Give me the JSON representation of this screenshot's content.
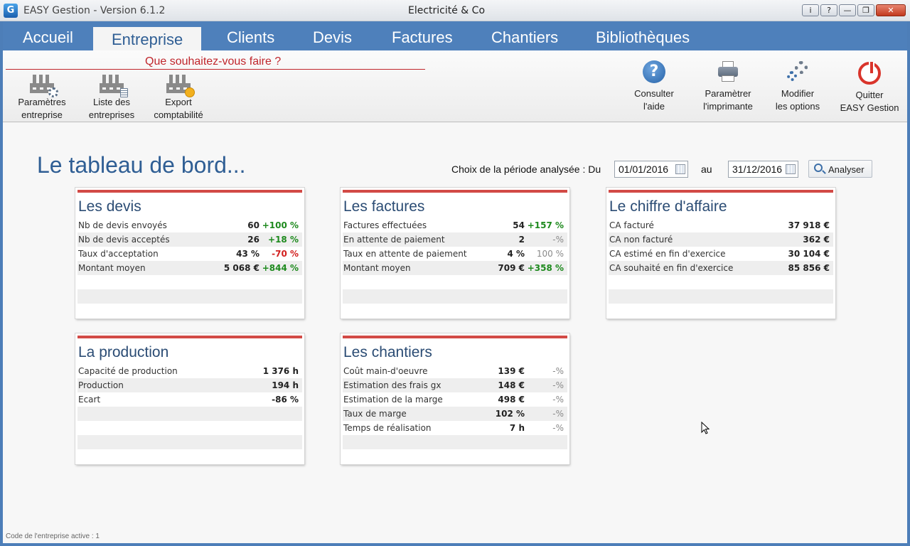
{
  "window": {
    "app_title": "EASY Gestion - Version 6.1.2",
    "company_title": "Electricité & Co",
    "app_icon": "G",
    "controls": [
      "i",
      "?",
      "—",
      "❐",
      "✕"
    ]
  },
  "nav": {
    "tabs": [
      "Accueil",
      "Entreprise",
      "Clients",
      "Devis",
      "Factures",
      "Chantiers",
      "Bibliothèques"
    ],
    "active": "Entreprise"
  },
  "ribbon": {
    "heading": "Que souhaitez-vous faire ?",
    "left_buttons": [
      {
        "line1": "Paramètres",
        "line2": "entreprise",
        "icon": "factory-gear-icon"
      },
      {
        "line1": "Liste des",
        "line2": "entreprises",
        "icon": "factory-list-icon"
      },
      {
        "line1": "Export",
        "line2": "comptabilité",
        "icon": "factory-export-icon"
      }
    ],
    "right_buttons": [
      {
        "line1": "Consulter",
        "line2": "l'aide",
        "icon": "help-icon"
      },
      {
        "line1": "Paramètrer",
        "line2": "l'imprimante",
        "icon": "printer-icon"
      },
      {
        "line1": "Modifier",
        "line2": "les options",
        "icon": "gears-icon"
      },
      {
        "line1": "Quitter",
        "line2": "EASY Gestion",
        "icon": "power-icon"
      }
    ]
  },
  "dashboard": {
    "title": "Le tableau de bord...",
    "period_label": "Choix de la période analysée : Du",
    "from_date": "01/01/2016",
    "to_label": "au",
    "to_date": "31/12/2016",
    "analyze_label": "Analyser"
  },
  "cards": {
    "devis": {
      "title": "Les devis",
      "rows": [
        {
          "label": "Nb de devis envoyés",
          "value": "60",
          "pct": "+100 %"
        },
        {
          "label": "Nb de devis acceptés",
          "value": "26",
          "pct": "+18 %"
        },
        {
          "label": "Taux d'acceptation",
          "value": "43 %",
          "pct": "-70 %"
        },
        {
          "label": "Montant moyen",
          "value": "5 068 €",
          "pct": "+844 %"
        }
      ]
    },
    "factures": {
      "title": "Les factures",
      "rows": [
        {
          "label": "Factures effectuées",
          "value": "54",
          "pct": "+157 %"
        },
        {
          "label": "En attente de paiement",
          "value": "2",
          "pct": "-%"
        },
        {
          "label": "Taux en attente de paiement",
          "value": "4 %",
          "pct": "100 %"
        },
        {
          "label": "Montant moyen",
          "value": "709 €",
          "pct": "+358 %"
        }
      ]
    },
    "ca": {
      "title": "Le chiffre d'affaire",
      "rows": [
        {
          "label": "CA facturé",
          "value": "37 918 €"
        },
        {
          "label": "CA non facturé",
          "value": "362 €"
        },
        {
          "label": "CA estimé en fin d'exercice",
          "value": "30 104 €"
        },
        {
          "label": "CA souhaité en fin d'exercice",
          "value": "85 856 €"
        }
      ]
    },
    "production": {
      "title": "La production",
      "rows": [
        {
          "label": "Capacité de production",
          "value": "1 376 h"
        },
        {
          "label": "Production",
          "value": "194 h"
        },
        {
          "label": "Ecart",
          "value": "-86 %"
        }
      ]
    },
    "chantiers": {
      "title": "Les chantiers",
      "rows": [
        {
          "label": "Coût main-d'oeuvre",
          "value": "139 €",
          "pct": "-%"
        },
        {
          "label": "Estimation des frais gx",
          "value": "148 €",
          "pct": "-%"
        },
        {
          "label": "Estimation de la marge",
          "value": "498 €",
          "pct": "-%"
        },
        {
          "label": "Taux de marge",
          "value": "102 %",
          "pct": "-%"
        },
        {
          "label": "Temps de réalisation",
          "value": "7 h",
          "pct": "-%"
        }
      ]
    }
  },
  "footer": "Code de l'entreprise active : 1",
  "colors": {
    "nav_blue": "#4e80bb",
    "card_accent": "#d24a46",
    "positive": "#1e8a1e",
    "negative": "#d2201f",
    "heading_red": "#c0262c"
  }
}
